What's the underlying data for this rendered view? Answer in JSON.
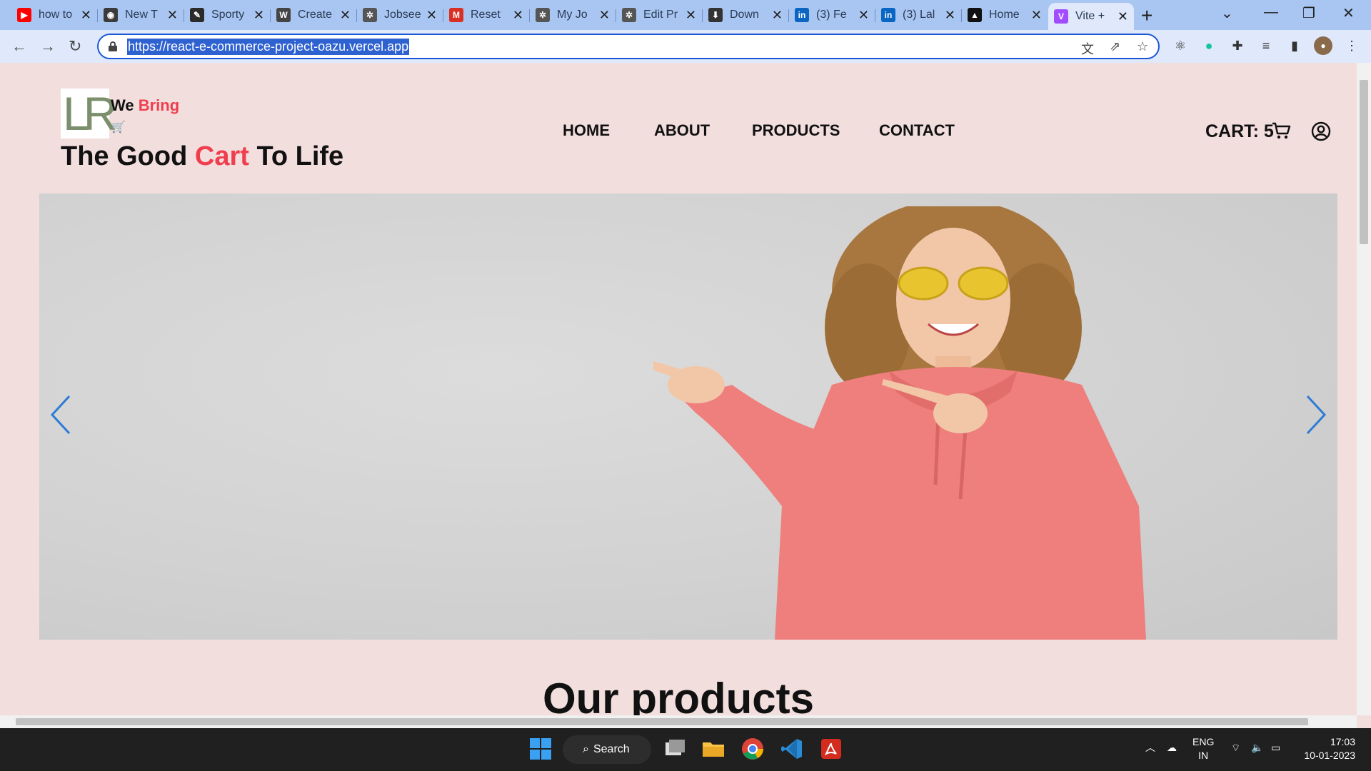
{
  "browser": {
    "tabs": [
      {
        "title": "how to",
        "fav": "youtube-icon",
        "color": "#ff0000",
        "glyph": "▶"
      },
      {
        "title": "New T",
        "fav": "chrome-icon",
        "color": "#3b3b3b",
        "glyph": "◉"
      },
      {
        "title": "Sporty",
        "fav": "pencil-icon",
        "color": "#2b2b2b",
        "glyph": "✎"
      },
      {
        "title": "Create",
        "fav": "w-icon",
        "color": "#444444",
        "glyph": "W"
      },
      {
        "title": "Jobsee",
        "fav": "gear-icon",
        "color": "#555555",
        "glyph": "✲"
      },
      {
        "title": "Reset",
        "fav": "gmail-icon",
        "color": "#d93025",
        "glyph": "M"
      },
      {
        "title": "My Jo",
        "fav": "gear-icon",
        "color": "#555555",
        "glyph": "✲"
      },
      {
        "title": "Edit Pr",
        "fav": "gear-icon",
        "color": "#555555",
        "glyph": "✲"
      },
      {
        "title": "Down",
        "fav": "download-icon",
        "color": "#333333",
        "glyph": "⬇"
      },
      {
        "title": "(3) Fe",
        "fav": "linkedin-icon",
        "color": "#0a66c2",
        "glyph": "in"
      },
      {
        "title": "(3) Lal",
        "fav": "linkedin-icon",
        "color": "#0a66c2",
        "glyph": "in"
      },
      {
        "title": "Home",
        "fav": "triangle-icon",
        "color": "#111111",
        "glyph": "▲"
      },
      {
        "title": "Vite +",
        "fav": "vite-icon",
        "color": "#a14dff",
        "glyph": "V"
      }
    ],
    "url": "https://react-e-commerce-project-oazu.vercel.app"
  },
  "header": {
    "logo_letters": "LR",
    "tagline_we": "We",
    "tagline_bring": "Bring",
    "title_the_good": "The Good",
    "title_cart": "Cart",
    "title_to_life": "To Life",
    "accent_color": "#ef3e4d"
  },
  "nav": {
    "items": [
      "HOME",
      "ABOUT",
      "PRODUCTS",
      "CONTACT"
    ]
  },
  "cart": {
    "label": "CART: 5"
  },
  "main": {
    "section_title": "Our products"
  },
  "taskbar": {
    "search_label": "Search",
    "lang_top": "ENG",
    "lang_bottom": "IN",
    "time": "17:03",
    "date": "10-01-2023"
  }
}
